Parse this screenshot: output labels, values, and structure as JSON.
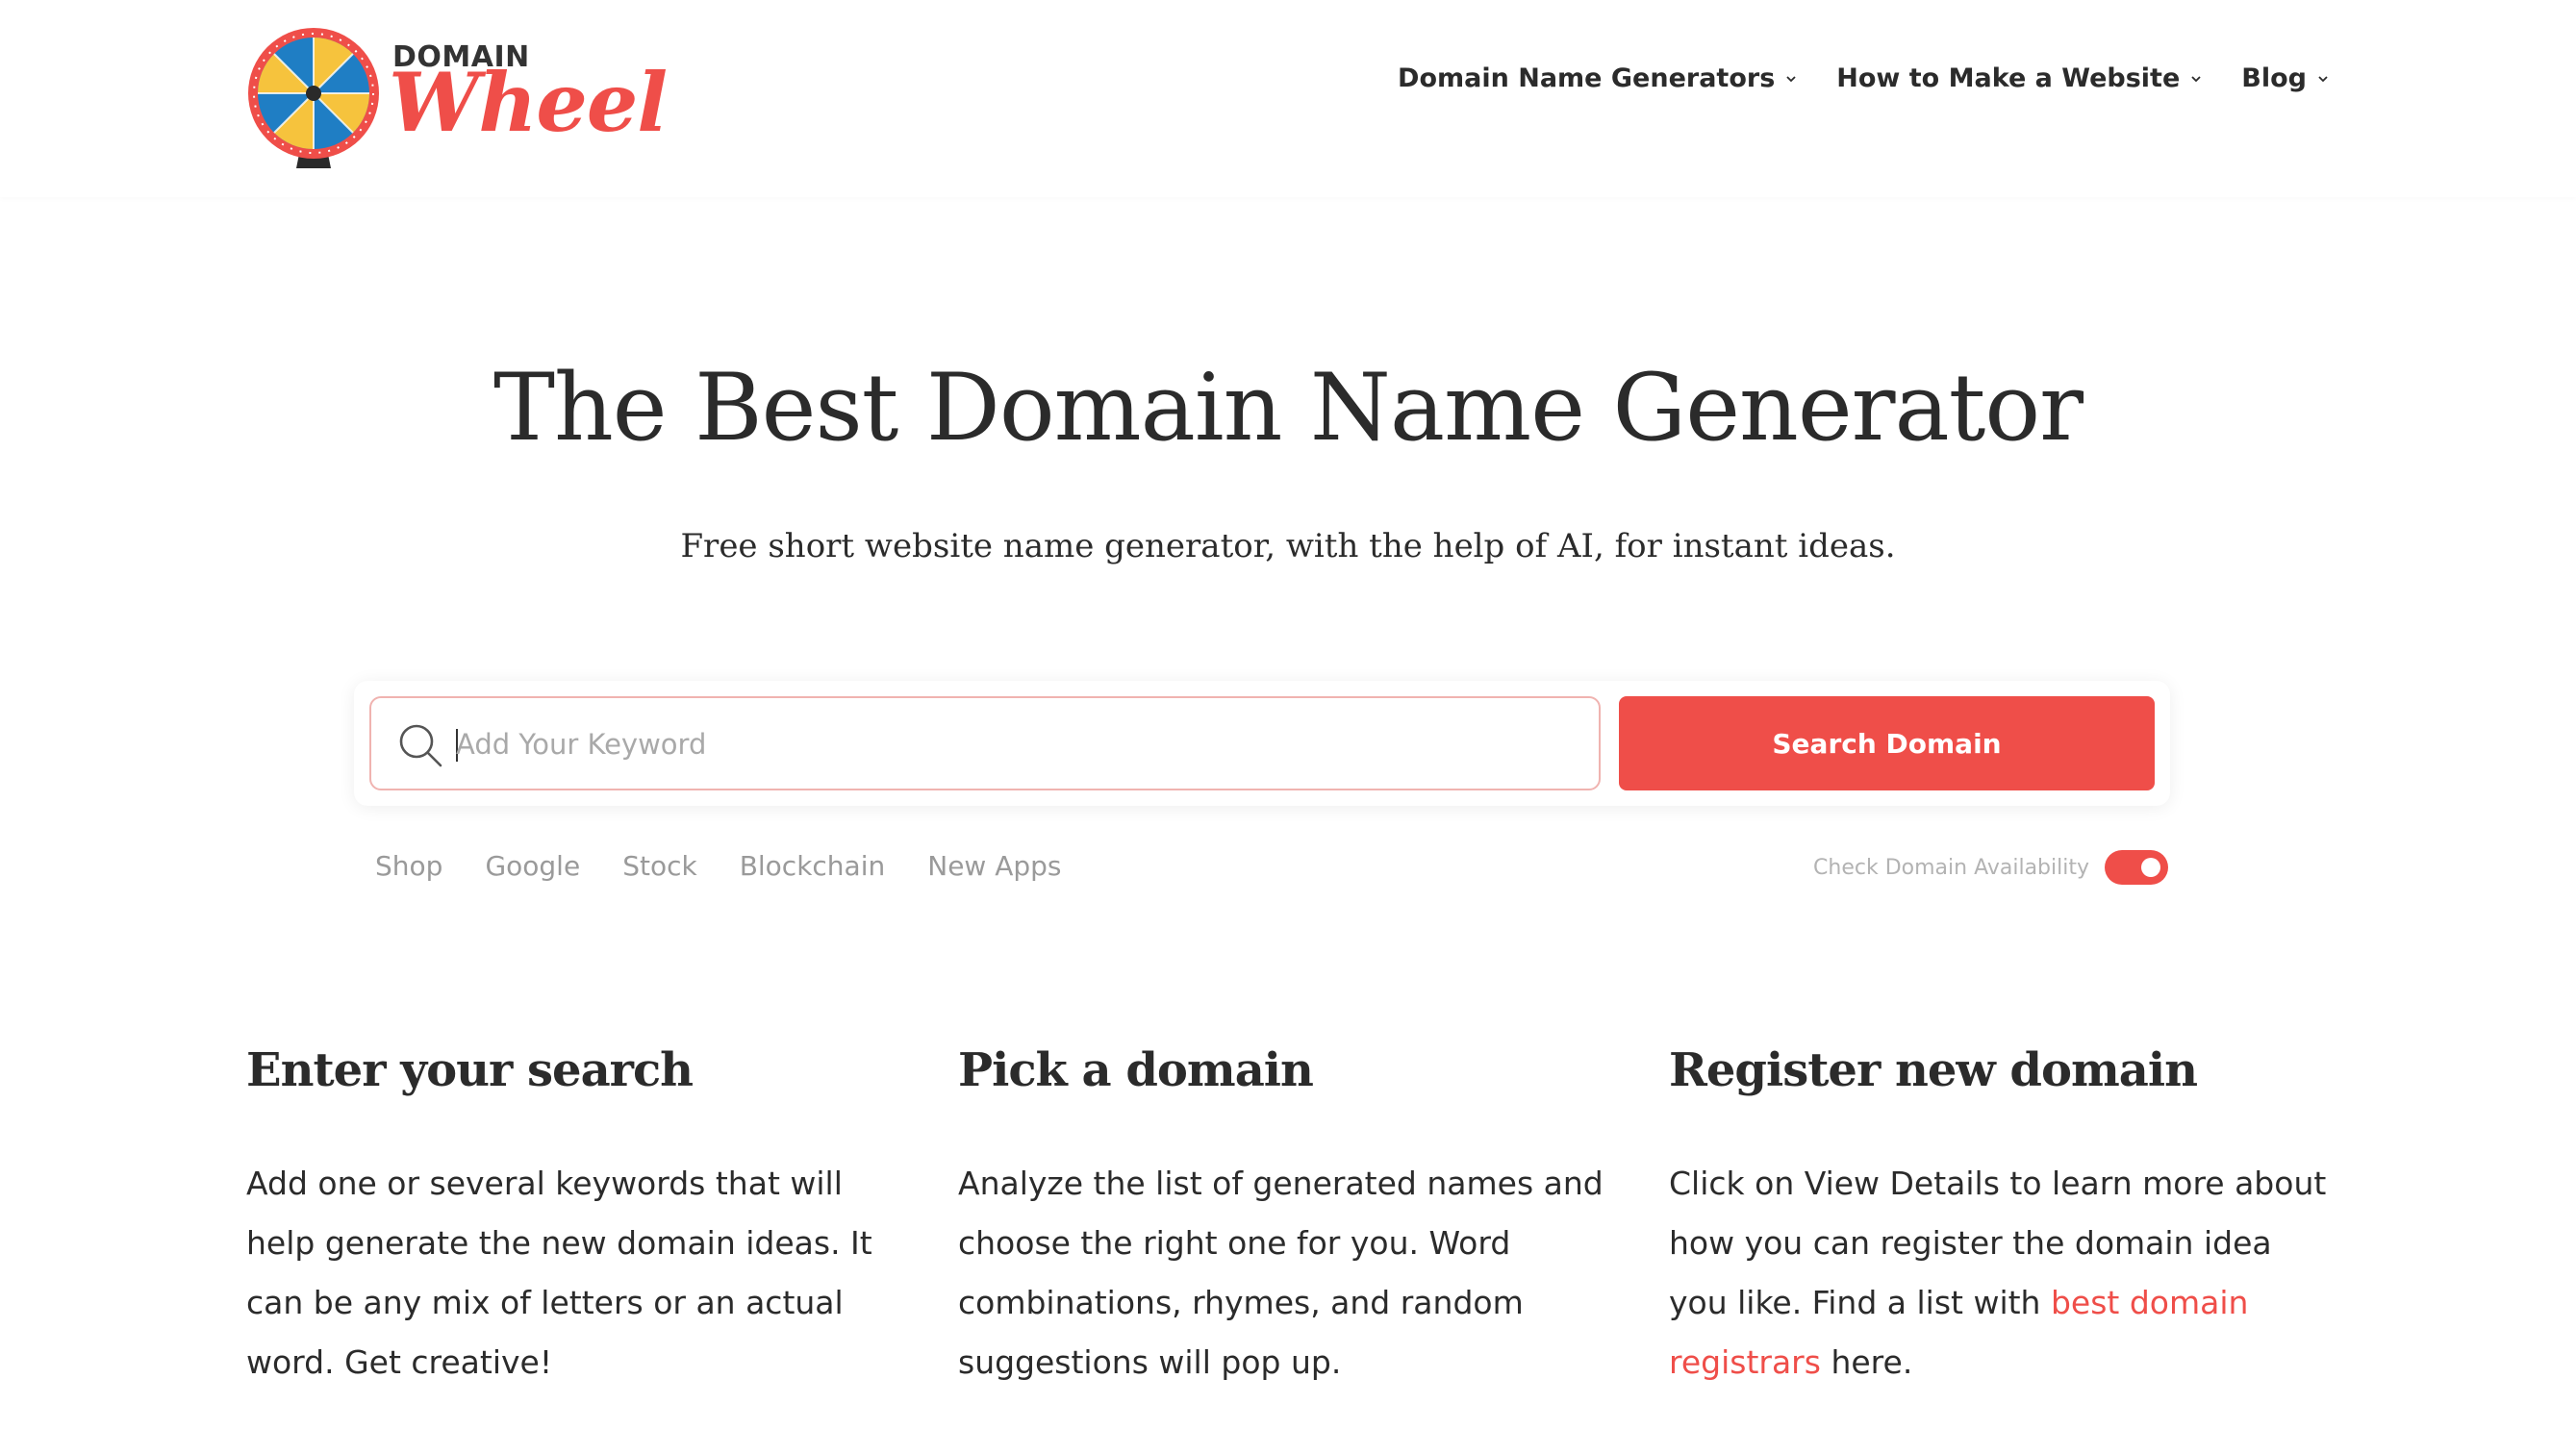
{
  "brand": {
    "logo_top": "DOMAIN",
    "logo_main": "Wheel",
    "accent_color": "#ef4e49"
  },
  "nav": {
    "items": [
      {
        "label": "Domain Name Generators",
        "icon": "chevron-down-icon"
      },
      {
        "label": "How to Make a Website",
        "icon": "chevron-down-icon"
      },
      {
        "label": "Blog",
        "icon": "chevron-down-icon"
      }
    ]
  },
  "hero": {
    "title": "The Best Domain Name Generator",
    "subtitle": "Free short website name generator, with the help of AI, for instant ideas."
  },
  "search": {
    "placeholder": "Add Your Keyword",
    "value": "",
    "button_label": "Search Domain",
    "icon": "search-icon"
  },
  "suggestions": [
    "Shop",
    "Google",
    "Stock",
    "Blockchain",
    "New Apps"
  ],
  "availability": {
    "label": "Check Domain Availability",
    "enabled": true
  },
  "steps": [
    {
      "title": "Enter your search",
      "text": "Add one or several keywords that will help generate the new domain ideas. It can be any mix of letters or an actual word. Get creative!"
    },
    {
      "title": "Pick a domain",
      "text": "Analyze the list of generated names and choose the right one for you. Word combinations, rhymes, and random suggestions will pop up."
    },
    {
      "title": "Register new domain",
      "text_before": "Click on View Details to learn more about how you can register the domain idea you like. Find a list with",
      "link_text": "best domain registrars",
      "text_after": "here."
    }
  ]
}
